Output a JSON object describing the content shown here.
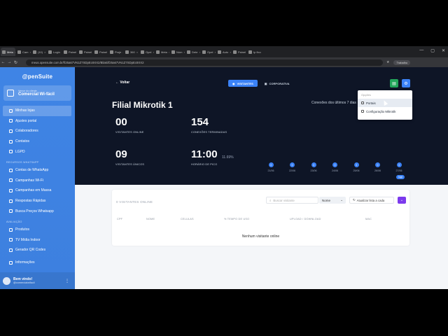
{
  "browser": {
    "tabs": [
      "Meta",
      "Cam",
      "(10)",
      "Login",
      "Painel",
      "Painel",
      "Painel",
      "Proje",
      "360",
      "Opel",
      "Meta",
      "Núm",
      "Dete",
      "Opel",
      "Auto",
      "Painel",
      "Ip fixo"
    ],
    "url": "meus.opensuite.com.br/f/25a67VN1Z7SDpEc8XX2/Bliaki/f25a67VN1Z7SDpEc8XX2",
    "profile_label": "Trabalho"
  },
  "sidebar": {
    "brand": "@penSuite",
    "org_small": "Venue do cliente",
    "org_name": "Comercial Wi-fácil",
    "items": [
      {
        "label": "Minhas lojas",
        "active": true
      },
      {
        "label": "Ajustes portal"
      },
      {
        "label": "Colaboradores"
      },
      {
        "label": "Contatos"
      },
      {
        "label": "LGPD"
      }
    ],
    "section_whatsapp": "RECURSOS WHATSAPP",
    "whatsapp_items": [
      {
        "label": "Contas de WhatsApp"
      },
      {
        "label": "Campanhas Wi-Fi"
      },
      {
        "label": "Campanhas em Massa"
      },
      {
        "label": "Respostas Rápidas"
      },
      {
        "label": "Busca Preços Whatsapp"
      }
    ],
    "section_other": "AVALIAÇÃO",
    "other_items": [
      {
        "label": "Produtos"
      },
      {
        "label": "TV Mídia Indoor"
      },
      {
        "label": "Gerador QR Codes"
      }
    ],
    "info_item": "Informações",
    "user_greeting": "Bem vindo!",
    "user_email": "@comercialwifacil"
  },
  "header": {
    "back_label": "Voltar",
    "seg_visitantes": "VISITANTES",
    "seg_corporativa": "CORPORATIVA"
  },
  "page_title": "Filial Mikrotik 1",
  "stats": {
    "online_value": "00",
    "online_label": "VISITANTES ONLINE",
    "ended_value": "154",
    "ended_label": "CONEXÕES TERMINADAS",
    "unique_value": "09",
    "unique_label": "VISITANTES ÚNICOS",
    "peak_value": "11:00",
    "peak_label": "HORÁRIO DE PICO",
    "peak_pct": "11.69%"
  },
  "chart_data": {
    "type": "bar",
    "title": "Conexões dos últimos 7 dias",
    "categories": [
      "21/06",
      "22/06",
      "23/06",
      "24/06",
      "25/06",
      "26/06",
      "27/06"
    ],
    "values": [
      3,
      0,
      3,
      0,
      3,
      0,
      3
    ],
    "today_label": "hoje"
  },
  "dropdown": {
    "section": "Opções",
    "items": [
      "Portais",
      "Configuração Mikrotik"
    ]
  },
  "colors": {
    "accent": "#3b82f6",
    "sidebar": "#3f84e5",
    "dark_bg": "#0e1526",
    "green_button": "#22a55a",
    "purple_button": "#7c3aed"
  },
  "visitors": {
    "heading": "0 VISITANTES ONLINE",
    "search_placeholder": "Buscar visitante",
    "sort_value": "Nome",
    "refresh_label": "Atualizar lista a cada",
    "columns": [
      "CPF",
      "NOME",
      "CELULAS",
      "% TEMPO DE USO",
      "UPLOAD / DOWNLOAD",
      "MAC"
    ],
    "empty_message": "Nenhum visitante online"
  }
}
